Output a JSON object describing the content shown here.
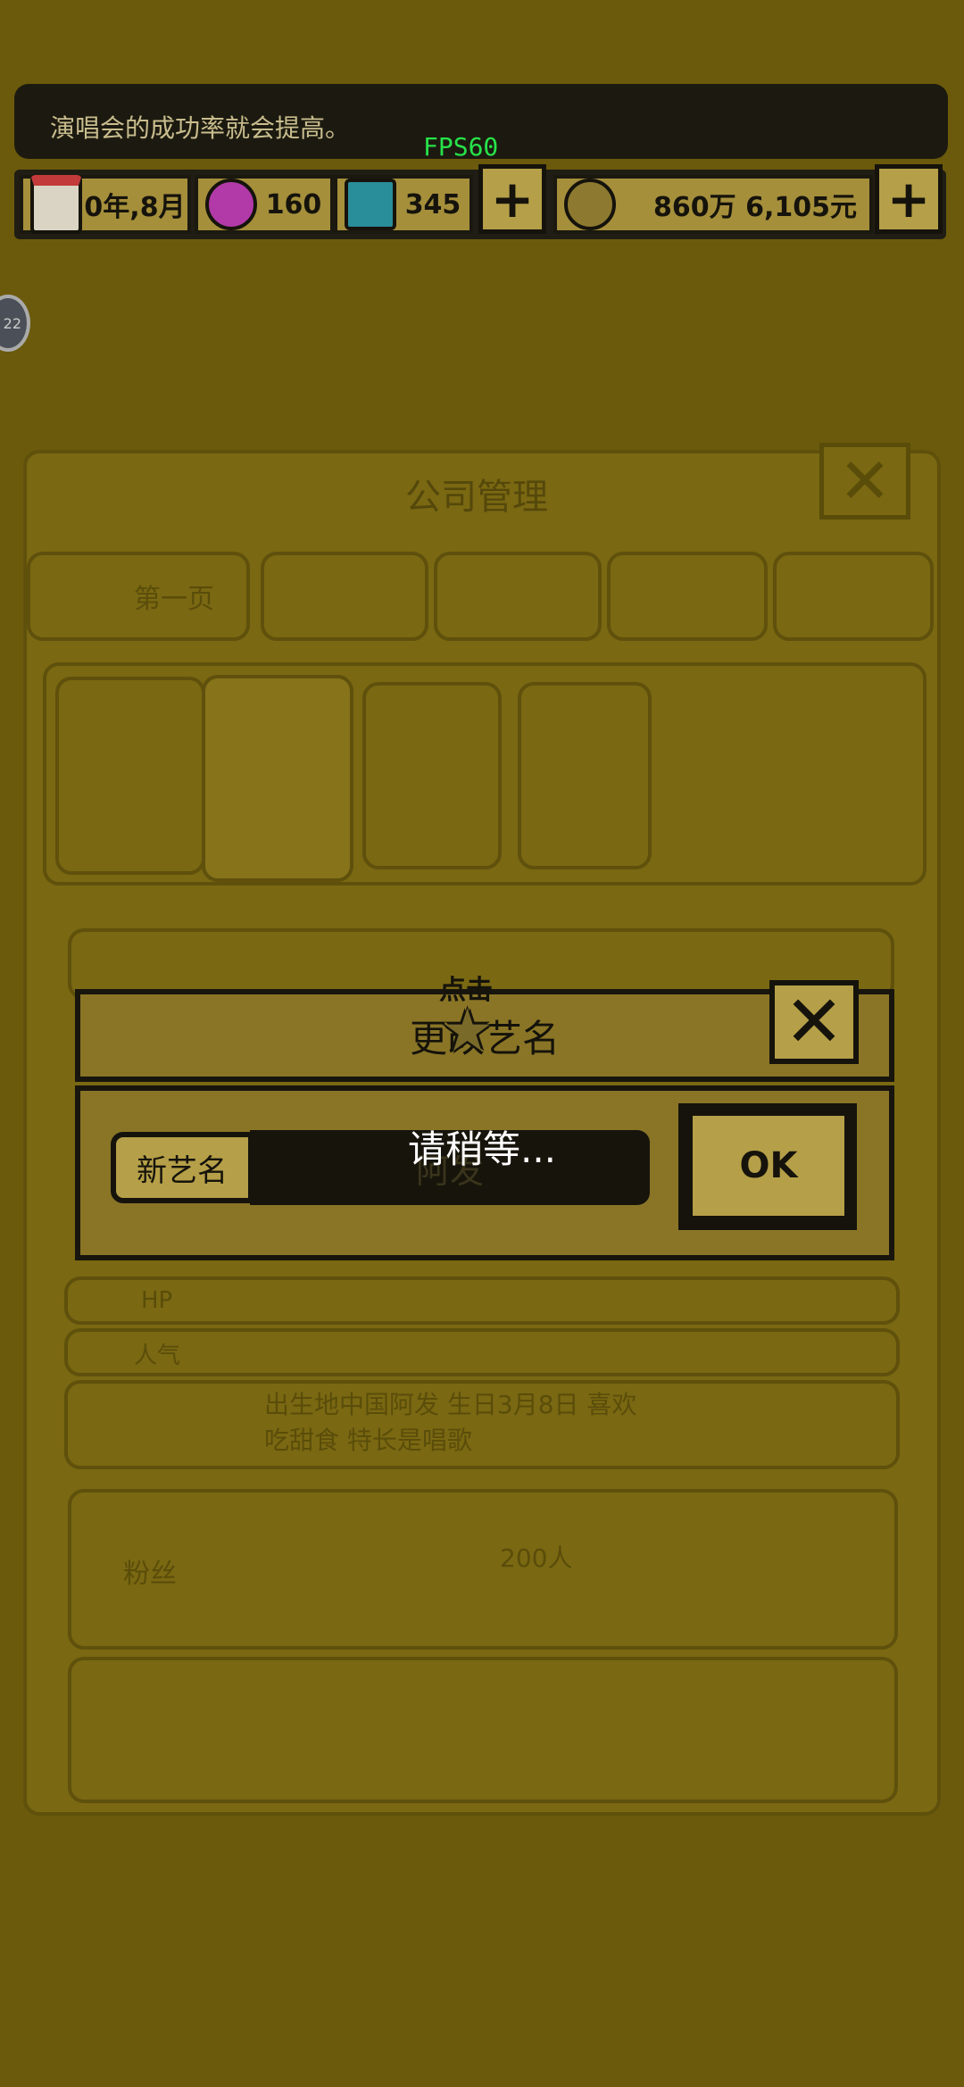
{
  "notice": {
    "text": "演唱会的成功率就会提高。"
  },
  "fps": "FPS60",
  "resources": {
    "date": "0年,8月",
    "gem_pink": "160",
    "gem_blue": "345",
    "money": "860万 6,105元"
  },
  "side_badge": "22",
  "background": {
    "panel_title": "公司管理",
    "tab_first": "第一页",
    "stats_row1_label": "HP",
    "stats_row2_label": "人气",
    "profile_text": "出生地中国阿发 生日3月8日 喜欢吃甜食 特长是唱歌",
    "fans": "粉丝",
    "fans_count": "200人"
  },
  "dialog": {
    "tap_hint": "点击",
    "title": "更改艺名",
    "field_label": "新艺名",
    "field_value": "阿发",
    "ok_label": "OK",
    "close_icon": "close-icon"
  },
  "loading": {
    "text": "请稍等..."
  },
  "colors": {
    "accent": "#b59f48",
    "dark": "#15130b",
    "fps": "#27e24a"
  }
}
